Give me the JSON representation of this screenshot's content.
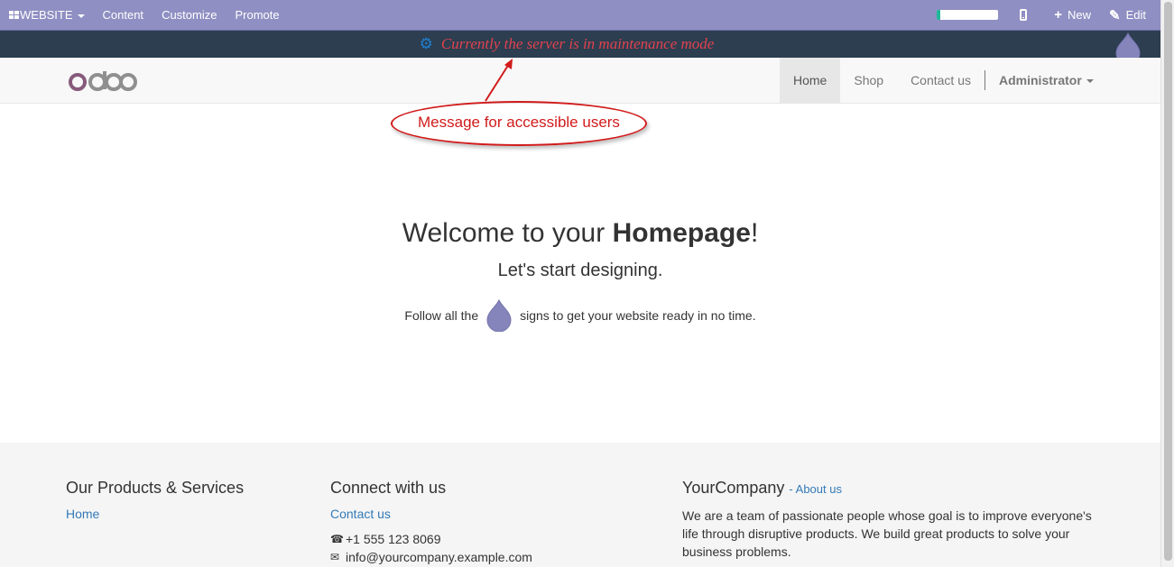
{
  "adminbar": {
    "website_label": "WEBSITE",
    "menu": [
      "Content",
      "Customize",
      "Promote"
    ],
    "progress_fraction": 0.05,
    "new_label": "New",
    "edit_label": "Edit"
  },
  "maintenance": {
    "message": "Currently the server is in maintenance mode",
    "icon": "cogs-icon"
  },
  "navbar": {
    "logo": "odoo",
    "items": [
      "Home",
      "Shop",
      "Contact us"
    ],
    "active": "Home",
    "user": "Administrator"
  },
  "annotation": {
    "text": "Message for accessible users",
    "color": "#d11b1b"
  },
  "welcome": {
    "title_prefix": "Welcome to your ",
    "title_bold": "Homepage",
    "title_suffix": "!",
    "subtitle": "Let's start designing.",
    "follow_before": "Follow all the",
    "follow_after": "signs to get your website ready in no time."
  },
  "footer": {
    "col1": {
      "title": "Our Products & Services",
      "link": "Home"
    },
    "col2": {
      "title": "Connect with us",
      "link": "Contact us",
      "phone": "+1 555 123 8069",
      "email": "info@yourcompany.example.com"
    },
    "col3": {
      "title": "YourCompany",
      "about": "- About us",
      "text": "We are a team of passionate people whose goal is to improve everyone's life through disruptive products. We build great products to solve your business problems."
    }
  },
  "colors": {
    "adminbar": "#8f8fc3",
    "maintenance_bg": "#2c3e50",
    "maintenance_text": "#e2424e",
    "link": "#337ab7",
    "drop": "#8585bb"
  }
}
